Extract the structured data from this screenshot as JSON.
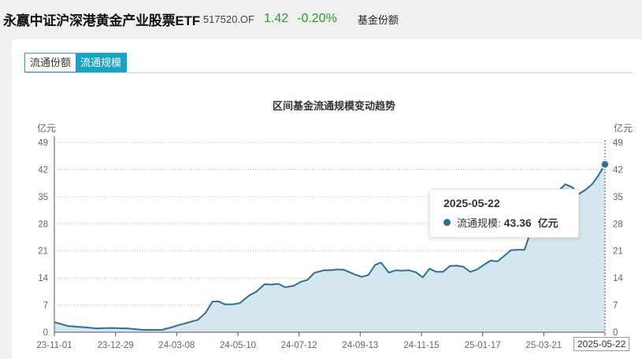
{
  "header": {
    "fund_name": "永嬴中证沪深港黄金产业股票ETF",
    "fund_code": "517520.OF",
    "price": "1.42",
    "change": "-0.20%",
    "tab_label": "基金份额"
  },
  "tabs": [
    {
      "label": "流通份额",
      "active": false
    },
    {
      "label": "流通规模",
      "active": true
    }
  ],
  "tooltip": {
    "date": "2025-05-22",
    "series_label": "流通规模:",
    "value": "43.36",
    "unit": "亿元"
  },
  "crosshair_label": "2025-05-22",
  "colors": {
    "line": "#2e7095",
    "area": "#d2e3ec",
    "accent": "#1aa3c2",
    "positive_change": "#2e9a2e"
  },
  "chart_data": {
    "type": "area",
    "title": "区间基金流通规模变动趋势",
    "y_unit_left": "亿元",
    "y_unit_right": "亿元",
    "ylim": [
      0,
      49
    ],
    "yticks": [
      0,
      7,
      14,
      21,
      28,
      35,
      42,
      49
    ],
    "xlim": [
      "2023-11-01",
      "2025-05-22"
    ],
    "xticks": [
      "23-11-01",
      "23-12-29",
      "24-03-08",
      "24-05-10",
      "24-07-12",
      "24-09-13",
      "24-11-15",
      "25-01-17",
      "25-03-21",
      "25-05-22"
    ],
    "grid": true,
    "series": [
      {
        "name": "流通规模",
        "points": [
          [
            "2023-11-01",
            2.6
          ],
          [
            "2023-11-15",
            1.6
          ],
          [
            "2023-12-01",
            1.3
          ],
          [
            "2023-12-15",
            1.0
          ],
          [
            "2023-12-29",
            1.1
          ],
          [
            "2024-01-15",
            1.0
          ],
          [
            "2024-01-31",
            0.6
          ],
          [
            "2024-02-20",
            0.6
          ],
          [
            "2024-03-01",
            1.3
          ],
          [
            "2024-03-08",
            1.8
          ],
          [
            "2024-03-18",
            2.5
          ],
          [
            "2024-03-28",
            3.2
          ],
          [
            "2024-04-05",
            5.0
          ],
          [
            "2024-04-12",
            7.9
          ],
          [
            "2024-04-18",
            8.0
          ],
          [
            "2024-04-25",
            7.2
          ],
          [
            "2024-05-03",
            7.2
          ],
          [
            "2024-05-10",
            7.5
          ],
          [
            "2024-05-20",
            9.5
          ],
          [
            "2024-05-27",
            10.4
          ],
          [
            "2024-06-05",
            12.4
          ],
          [
            "2024-06-12",
            12.3
          ],
          [
            "2024-06-19",
            12.5
          ],
          [
            "2024-06-26",
            11.6
          ],
          [
            "2024-07-05",
            12.0
          ],
          [
            "2024-07-12",
            13.0
          ],
          [
            "2024-07-19",
            13.5
          ],
          [
            "2024-07-26",
            15.3
          ],
          [
            "2024-08-05",
            16.0
          ],
          [
            "2024-08-12",
            16.0
          ],
          [
            "2024-08-19",
            16.2
          ],
          [
            "2024-08-26",
            16.1
          ],
          [
            "2024-09-05",
            15.0
          ],
          [
            "2024-09-13",
            14.3
          ],
          [
            "2024-09-20",
            14.8
          ],
          [
            "2024-09-27",
            17.4
          ],
          [
            "2024-10-03",
            18.0
          ],
          [
            "2024-10-11",
            15.4
          ],
          [
            "2024-10-18",
            16.0
          ],
          [
            "2024-10-25",
            15.9
          ],
          [
            "2024-11-01",
            16.0
          ],
          [
            "2024-11-08",
            15.5
          ],
          [
            "2024-11-15",
            14.2
          ],
          [
            "2024-11-22",
            16.4
          ],
          [
            "2024-11-29",
            15.6
          ],
          [
            "2024-12-06",
            15.6
          ],
          [
            "2024-12-13",
            17.1
          ],
          [
            "2024-12-20",
            17.2
          ],
          [
            "2024-12-27",
            16.9
          ],
          [
            "2025-01-03",
            15.6
          ],
          [
            "2025-01-10",
            16.2
          ],
          [
            "2025-01-17",
            17.4
          ],
          [
            "2025-01-24",
            18.5
          ],
          [
            "2025-01-31",
            18.3
          ],
          [
            "2025-02-07",
            19.7
          ],
          [
            "2025-02-14",
            21.2
          ],
          [
            "2025-02-21",
            21.3
          ],
          [
            "2025-02-28",
            21.3
          ],
          [
            "2025-03-07",
            26.5
          ],
          [
            "2025-03-14",
            29.5
          ],
          [
            "2025-03-21",
            31.5
          ],
          [
            "2025-03-28",
            34.0
          ],
          [
            "2025-04-04",
            36.4
          ],
          [
            "2025-04-11",
            38.2
          ],
          [
            "2025-04-18",
            37.5
          ],
          [
            "2025-04-25",
            35.7
          ],
          [
            "2025-05-02",
            36.8
          ],
          [
            "2025-05-09",
            38.3
          ],
          [
            "2025-05-15",
            40.4
          ],
          [
            "2025-05-22",
            43.36
          ]
        ]
      }
    ]
  }
}
